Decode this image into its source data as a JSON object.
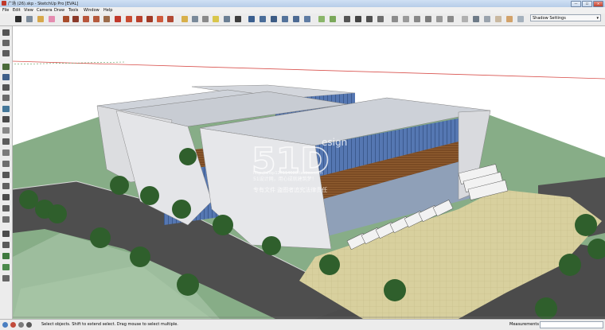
{
  "window": {
    "title": "广场 (26).skp - SketchUp Pro [EVAL]",
    "minimize": "—",
    "maximize": "☐",
    "close": "✕"
  },
  "menu": {
    "items": [
      "File",
      "Edit",
      "View",
      "Camera",
      "Draw",
      "Tools",
      "Window",
      "Help"
    ]
  },
  "shadow_settings": {
    "label": "Shadow Settings",
    "icon": "chevron-down-icon"
  },
  "watermark": {
    "logo": "51D",
    "logo_sub": "esign",
    "url": "http://shop127114680.taobao.com",
    "line1": "51设计网，用心成就建筑梦！",
    "line2": "专有文件  盗图者追究法律责任"
  },
  "status": {
    "text": "Select objects. Shift to extend select. Drag mouse to select multiple.",
    "measurements_label": "Measurements",
    "measurements_value": ""
  },
  "colors": {
    "sky": "#ffffff",
    "grass": "#86ad86",
    "road": "#4f4f4f",
    "plaza": "#d7cf9c",
    "roof": "#cfd3da",
    "glass": "#5a7ab5",
    "wood": "#7a4a23"
  }
}
